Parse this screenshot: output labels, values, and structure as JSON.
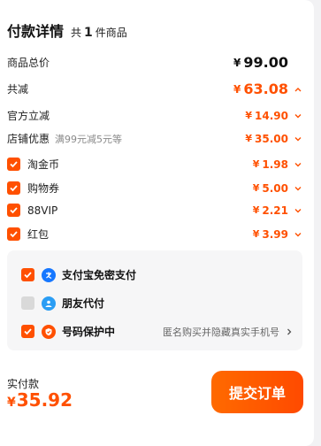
{
  "header": {
    "title": "付款详情",
    "count_prefix": "共",
    "count": "1",
    "count_suffix": "件商品"
  },
  "rows": {
    "total_goods": {
      "label": "商品总价",
      "currency": "¥",
      "amount": "99.00"
    },
    "total_discount": {
      "label": "共减",
      "currency": "¥",
      "amount": "63.08"
    },
    "official_discount": {
      "label": "官方立减",
      "currency": "¥",
      "amount": "14.90"
    },
    "shop_discount": {
      "label": "店铺优惠",
      "note": "满99元减5元等",
      "currency": "¥",
      "amount": "35.00"
    },
    "taojinbi": {
      "label": "淘金币",
      "currency": "¥",
      "amount": "1.98"
    },
    "coupon": {
      "label": "购物券",
      "currency": "¥",
      "amount": "5.00"
    },
    "vip88": {
      "label": "88VIP",
      "currency": "¥",
      "amount": "2.21"
    },
    "red_packet": {
      "label": "红包",
      "currency": "¥",
      "amount": "3.99"
    }
  },
  "payment_options": {
    "alipay": {
      "label": "支付宝免密支付",
      "checked": true
    },
    "friend_pay": {
      "label": "朋友代付",
      "checked": false
    },
    "number_protect": {
      "label": "号码保护中",
      "note": "匿名购买并隐藏真实手机号",
      "checked": true
    }
  },
  "footer": {
    "label": "实付款",
    "currency": "¥",
    "amount": "35.92",
    "submit_label": "提交订单"
  },
  "colors": {
    "accent": "#ff5000",
    "alipay_blue": "#1677ff",
    "friend_blue": "#2a9df4"
  },
  "icons": [
    "chevron-up-icon",
    "chevron-down-icon",
    "check-icon",
    "alipay-icon",
    "friend-pay-icon",
    "shield-icon",
    "chevron-right-icon"
  ]
}
